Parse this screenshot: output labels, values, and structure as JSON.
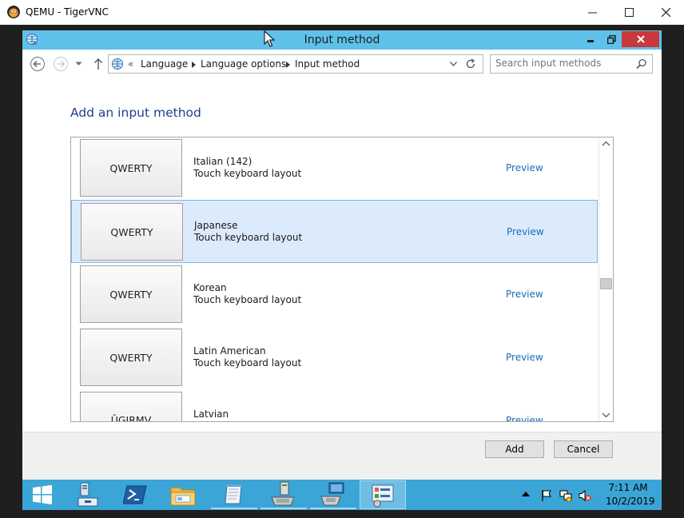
{
  "vnc": {
    "title": "QEMU - TigerVNC"
  },
  "window": {
    "title": "Input method"
  },
  "address": {
    "overflow": "«",
    "crumbs": [
      "Language",
      "Language options",
      "Input method"
    ]
  },
  "search": {
    "placeholder": "Search input methods"
  },
  "page": {
    "heading": "Add an input method"
  },
  "methods": [
    {
      "keyboard": "QWERTY",
      "name": "Italian (142)",
      "type": "Touch keyboard layout",
      "preview": "Preview",
      "selected": false
    },
    {
      "keyboard": "QWERTY",
      "name": "Japanese",
      "type": "Touch keyboard layout",
      "preview": "Preview",
      "selected": true
    },
    {
      "keyboard": "QWERTY",
      "name": "Korean",
      "type": "Touch keyboard layout",
      "preview": "Preview",
      "selected": false
    },
    {
      "keyboard": "QWERTY",
      "name": "Latin American",
      "type": "Touch keyboard layout",
      "preview": "Preview",
      "selected": false
    },
    {
      "keyboard": "ŪGJRMV",
      "name": "Latvian",
      "type": "",
      "preview": "Preview",
      "selected": false
    }
  ],
  "footer": {
    "add_label": "Add",
    "cancel_label": "Cancel"
  },
  "taskbar": {
    "apps": [
      "start-icon",
      "server-manager-icon",
      "powershell-icon",
      "file-explorer-icon",
      "notepad-icon",
      "network-computer-icon",
      "remote-computer-icon",
      "control-panel-icon"
    ],
    "tray": [
      "show-hidden-icons-icon",
      "flag-icon",
      "network-icon",
      "volume-muted-icon"
    ],
    "time": "7:11 AM",
    "date": "10/2/2019"
  },
  "colors": {
    "titlebar": "#5ec1e9",
    "taskbar": "#3aa5d6",
    "link": "#1c6bbf",
    "heading": "#1e3f8f",
    "selection": "#dcebfc",
    "close": "#c8383c"
  }
}
